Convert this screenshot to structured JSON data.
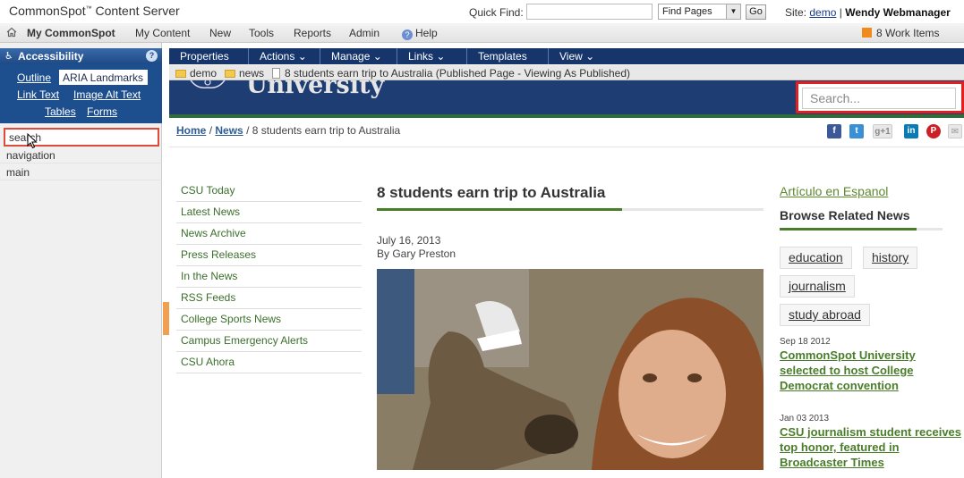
{
  "topbar": {
    "brand": "CommonSpot",
    "brand_tm": "™",
    "brand_suffix": " Content Server",
    "quick_find_label": "Quick Find:",
    "quick_find_value": "",
    "find_select": "Find Pages",
    "go_label": "Go",
    "site_label": "Site:",
    "site_name": "demo",
    "separator": "|",
    "user": "Wendy Webmanager"
  },
  "menubar": {
    "items": [
      "My CommonSpot",
      "My Content",
      "New",
      "Tools",
      "Reports",
      "Admin",
      "Help"
    ],
    "work_items": "8 Work Items"
  },
  "accessibility": {
    "title": "Accessibility",
    "help": "?",
    "tabs": [
      "Outline",
      "ARIA Landmarks",
      "Link Text",
      "Image Alt Text",
      "Tables",
      "Forms"
    ],
    "landmarks": [
      "search",
      "navigation",
      "main"
    ]
  },
  "page_menu": [
    "Properties",
    "Actions",
    "Manage",
    "Links",
    "Templates",
    "View"
  ],
  "crumb_bar": {
    "folder1": "demo",
    "folder2": "news",
    "page": "8 students earn trip to Australia (Published Page - Viewing As Published)"
  },
  "site_header": {
    "university": "University",
    "search_placeholder": "Search..."
  },
  "breadcrumb": {
    "home": "Home",
    "sep": "/",
    "news": "News",
    "current": "8 students earn trip to Australia"
  },
  "share_icons": [
    "f",
    "t",
    "g+1",
    "in",
    "P",
    "✉"
  ],
  "left_nav": [
    "CSU Today",
    "Latest News",
    "News Archive",
    "Press Releases",
    "In the News",
    "RSS Feeds",
    "College Sports News",
    "Campus Emergency Alerts",
    "CSU Ahora"
  ],
  "article": {
    "title": "8 students earn trip to Australia",
    "date": "July 16, 2013",
    "byline": "By Gary Preston"
  },
  "sidebar": {
    "espanol": "Artículo en Espanol",
    "browse_heading": "Browse Related News",
    "tags": [
      "education",
      "history",
      "journalism",
      "study abroad"
    ],
    "related": [
      {
        "date": "Sep 18 2012",
        "title": "CommonSpot University selected to host College Democrat convention"
      },
      {
        "date": "Jan 03 2013",
        "title": "CSU journalism student receives top honor, featured in Broadcaster Times"
      }
    ]
  },
  "colors": {
    "nav_blue": "#15356b",
    "brand_green": "#4a7d2a",
    "highlight_red": "#e0201e"
  }
}
